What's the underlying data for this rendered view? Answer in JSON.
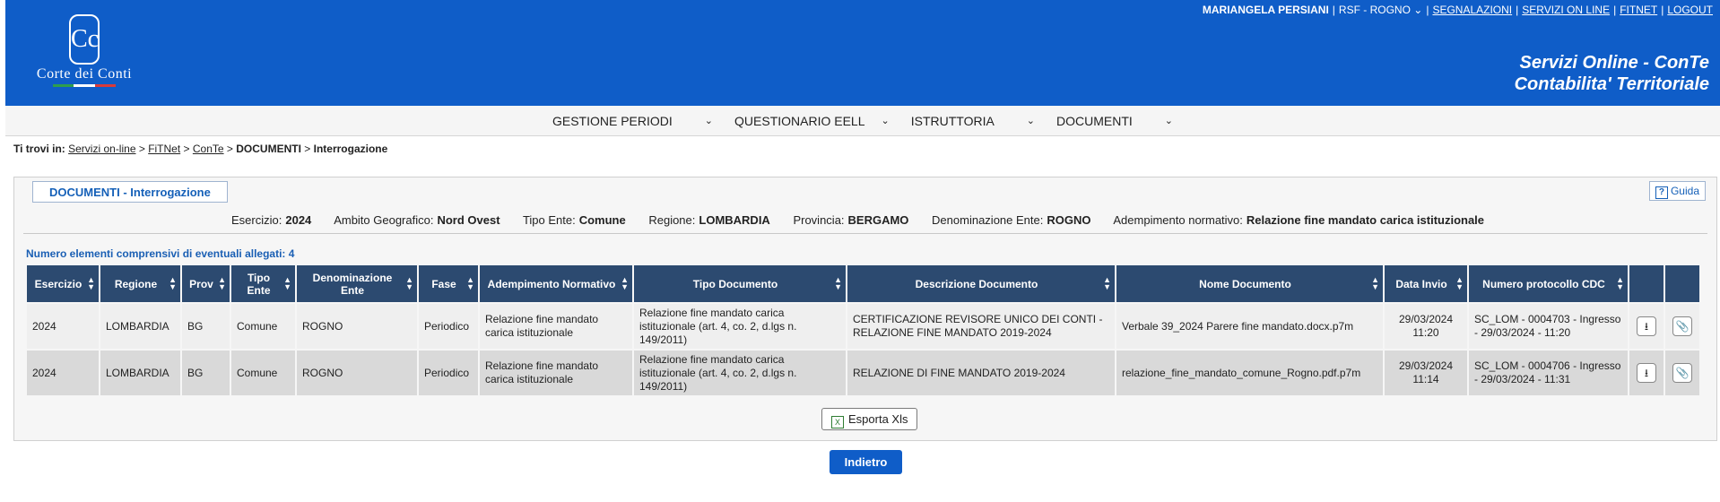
{
  "header": {
    "logo_text": "Corte dei Conti",
    "logo_symbol": "Cc",
    "user_name": "MARIANGELA PERSIANI",
    "role": "RSF - ROGNO",
    "links": [
      "SEGNALAZIONI",
      "SERVIZI ON LINE",
      "FITNET",
      "LOGOUT"
    ],
    "title_line1": "Servizi Online - ConTe",
    "title_line2": "Contabilita' Territoriale",
    "brand_color": "#0f5dc8"
  },
  "menu": [
    {
      "label": "GESTIONE PERIODI"
    },
    {
      "label": "QUESTIONARIO EELL"
    },
    {
      "label": "ISTRUTTORIA"
    },
    {
      "label": "DOCUMENTI"
    }
  ],
  "breadcrumb": {
    "prefix": "Ti trovi in:",
    "items": [
      "Servizi on-line",
      "FiTNet",
      "ConTe",
      "DOCUMENTI",
      "Interrogazione"
    ]
  },
  "panel": {
    "tab_title": "DOCUMENTI - Interrogazione",
    "guide_label": "Guida",
    "filters": [
      {
        "label": "Esercizio:",
        "value": "2024"
      },
      {
        "label": "Ambito Geografico:",
        "value": "Nord Ovest"
      },
      {
        "label": "Tipo Ente:",
        "value": "Comune"
      },
      {
        "label": "Regione:",
        "value": "LOMBARDIA"
      },
      {
        "label": "Provincia:",
        "value": "BERGAMO"
      },
      {
        "label": "Denominazione Ente:",
        "value": "ROGNO"
      },
      {
        "label": "Adempimento normativo:",
        "value": "Relazione fine mandato carica istituzionale"
      }
    ],
    "count_text": "Numero elementi comprensivi di eventuali allegati: 4"
  },
  "table": {
    "headers": [
      "Esercizio",
      "Regione",
      "Prov",
      "Tipo Ente",
      "Denominazione Ente",
      "Fase",
      "Adempimento Normativo",
      "Tipo Documento",
      "Descrizione Documento",
      "Nome Documento",
      "Data Invio",
      "Numero protocollo CDC"
    ],
    "rows": [
      [
        "2024",
        "LOMBARDIA",
        "BG",
        "Comune",
        "ROGNO",
        "Periodico",
        "Relazione fine mandato carica istituzionale",
        "Relazione fine mandato carica istituzionale (art. 4, co. 2, d.lgs n. 149/2011)",
        "CERTIFICAZIONE REVISORE UNICO DEI CONTI - RELAZIONE FINE MANDATO 2019-2024",
        "Verbale 39_2024 Parere fine mandato.docx.p7m",
        "29/03/2024 11:20",
        "SC_LOM - 0004703 - Ingresso - 29/03/2024 - 11:20"
      ],
      [
        "2024",
        "LOMBARDIA",
        "BG",
        "Comune",
        "ROGNO",
        "Periodico",
        "Relazione fine mandato carica istituzionale",
        "Relazione fine mandato carica istituzionale (art. 4, co. 2, d.lgs n. 149/2011)",
        "RELAZIONE DI FINE MANDATO 2019-2024",
        "relazione_fine_mandato_comune_Rogno.pdf.p7m",
        "29/03/2024 11:14",
        "SC_LOM - 0004706 - Ingresso - 29/03/2024 - 11:31"
      ]
    ]
  },
  "actions": {
    "export_label": "Esporta Xls",
    "back_label": "Indietro"
  }
}
